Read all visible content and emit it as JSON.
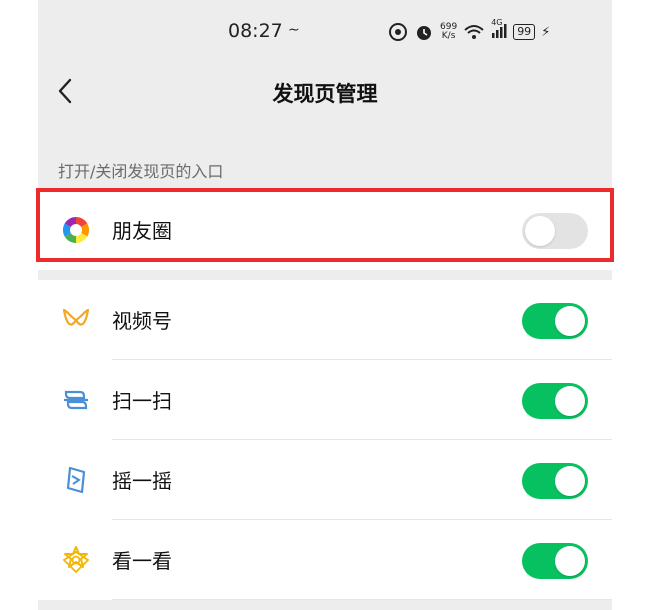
{
  "status_bar": {
    "time": "08:27",
    "speed_value": "699",
    "speed_unit": "K/s",
    "network": "4G",
    "battery": "99"
  },
  "header": {
    "title": "发现页管理"
  },
  "section": {
    "label": "打开/关闭发现页的入口"
  },
  "items": [
    {
      "label": "朋友圈",
      "icon": "moments-icon",
      "enabled": false
    },
    {
      "label": "视频号",
      "icon": "channels-icon",
      "enabled": true
    },
    {
      "label": "扫一扫",
      "icon": "scan-icon",
      "enabled": true
    },
    {
      "label": "摇一摇",
      "icon": "shake-icon",
      "enabled": true
    },
    {
      "label": "看一看",
      "icon": "top-stories-icon",
      "enabled": true
    }
  ],
  "colors": {
    "toggle_on": "#07c160",
    "toggle_off": "#e3e3e3",
    "highlight": "#ee2b2b",
    "icon_blue": "#4a90d9",
    "icon_orange": "#f5a623",
    "icon_gold": "#f2b705"
  }
}
